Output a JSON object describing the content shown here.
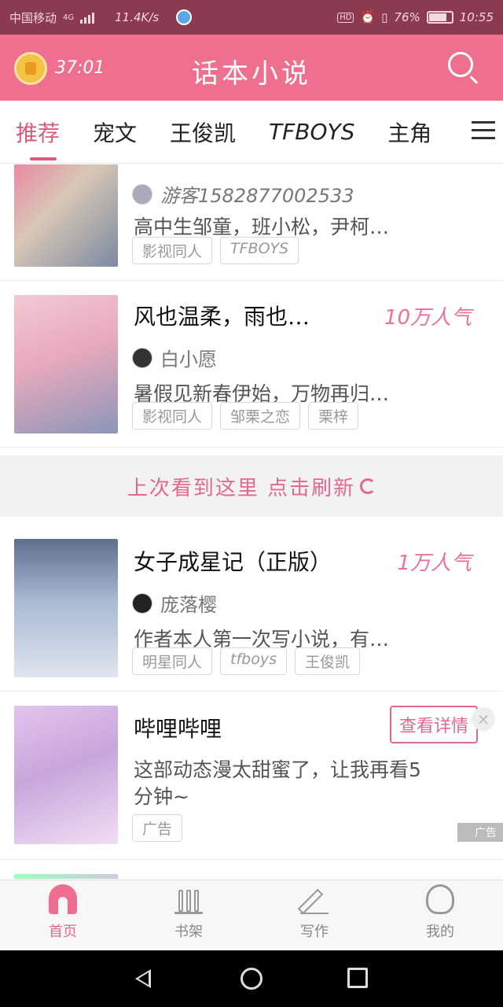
{
  "status": {
    "carrier": "中国移动",
    "network": "4G",
    "speed": "11.4K/s",
    "hd": "HD",
    "battery": "76%",
    "time": "10:55"
  },
  "header": {
    "timer": "37:01",
    "title": "话本小说"
  },
  "tabs": [
    "推荐",
    "宠文",
    "王俊凯",
    "TFBOYS",
    "主角"
  ],
  "items": [
    {
      "author": "游客1582877002533",
      "desc": "高中生邹童，班小松，尹柯…",
      "tags": [
        "影视同人",
        "TFBOYS"
      ],
      "cover_color": "#c9a3a9"
    },
    {
      "title": "风也温柔，雨也…",
      "popularity": "10万人气",
      "author": "白小愿",
      "desc": "暑假见新春伊始，万物再归…",
      "tags": [
        "影视同人",
        "邹栗之恋",
        "栗梓"
      ],
      "cover_color": "#e9b8c6"
    },
    {
      "title": "女子成星记（正版）",
      "popularity": "1万人气",
      "author": "庞落樱",
      "desc": "作者本人第一次写小说，有…",
      "tags": [
        "明星同人",
        "tfboys",
        "王俊凯"
      ],
      "cover_color": "#8aa3c2"
    }
  ],
  "refresh": {
    "label": "上次看到这里 点击刷新"
  },
  "ad": {
    "title": "哔哩哔哩",
    "button": "查看详情",
    "close": "×",
    "desc_line1": "这部动态漫太甜蜜了，让我再看5",
    "desc_line2": "分钟~",
    "tag": "广告",
    "badge": "广告",
    "cover_color": "#d7b6e6"
  },
  "bottom_nav": [
    "首页",
    "书架",
    "写作",
    "我的"
  ],
  "colors": {
    "accent": "#ef6f8f",
    "status_bar": "#8c3a50",
    "popularity": "#f07093"
  }
}
